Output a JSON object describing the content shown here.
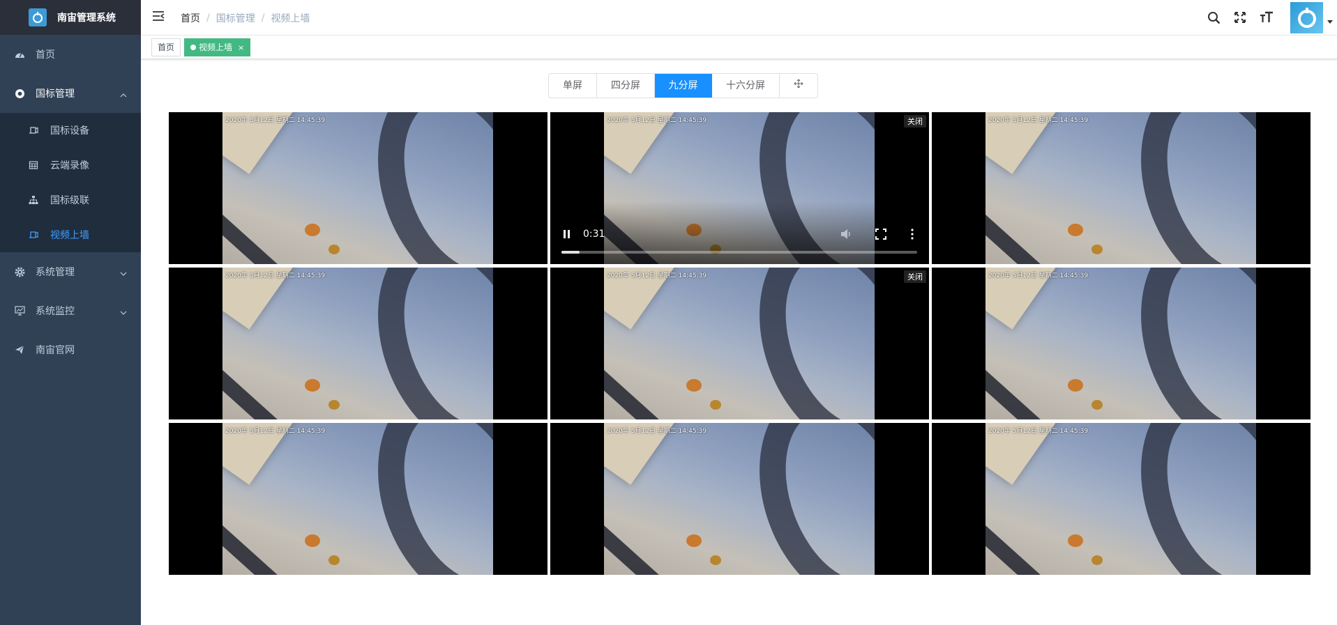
{
  "app": {
    "title": "南宙管理系统"
  },
  "sidebar": {
    "items": [
      {
        "label": "首页",
        "icon": "dashboard-icon"
      },
      {
        "label": "国标管理",
        "icon": "lifebuoy-icon",
        "expanded": true,
        "children": [
          {
            "label": "国标设备",
            "icon": "camera-icon"
          },
          {
            "label": "云端录像",
            "icon": "calendar-icon"
          },
          {
            "label": "国标级联",
            "icon": "tree-icon"
          },
          {
            "label": "视频上墙",
            "icon": "camera-icon",
            "active": true
          }
        ]
      },
      {
        "label": "系统管理",
        "icon": "gear-icon"
      },
      {
        "label": "系统监控",
        "icon": "monitor-icon"
      },
      {
        "label": "南宙官网",
        "icon": "send-icon"
      }
    ]
  },
  "breadcrumb": [
    "首页",
    "国标管理",
    "视频上墙"
  ],
  "tags": [
    {
      "label": "首页",
      "active": false
    },
    {
      "label": "视频上墙",
      "active": true,
      "close": "×"
    }
  ],
  "split_buttons": [
    {
      "label": "单屏"
    },
    {
      "label": "四分屏"
    },
    {
      "label": "九分屏",
      "active": true
    },
    {
      "label": "十六分屏"
    },
    {
      "label": "",
      "icon": "move-icon"
    }
  ],
  "video": {
    "osd_text": "2020年 5月12日 星期二 14:45:39",
    "close_label": "关闭",
    "time": "0:31",
    "progress": 0.05
  },
  "colors": {
    "sidebar_bg": "#304156",
    "active_blue": "#1890ff",
    "menu_active": "#409eff",
    "tag_green": "#42b983"
  }
}
